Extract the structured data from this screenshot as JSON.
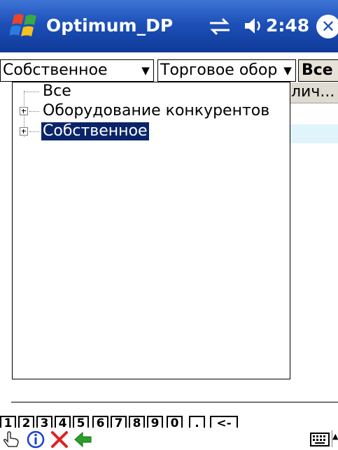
{
  "titlebar": {
    "app_title": "Optimum_DP",
    "clock": "2:48",
    "close_glyph": "✕",
    "icons": [
      "windows-start-icon",
      "sync-icon",
      "volume-icon",
      "close-icon"
    ]
  },
  "filters": {
    "combo1_value": "Собственное",
    "combo2_value": "Торговое обор",
    "all_button": "Все",
    "arrow_glyph": "▼"
  },
  "background_list": {
    "header_partial": "лич..."
  },
  "tree": {
    "nodes": [
      {
        "label": "Все",
        "expandable": false,
        "selected": false
      },
      {
        "label": "Оборудование конкурентов",
        "expandable": true,
        "selected": false
      },
      {
        "label": "Собственное",
        "expandable": true,
        "selected": true
      }
    ]
  },
  "keypad": {
    "keys": [
      "1",
      "2",
      "3",
      "4",
      "5",
      "6",
      "7",
      "8",
      "9",
      "0",
      ".",
      "<-"
    ]
  },
  "commandbar": {
    "icons": [
      "hand-icon",
      "info-icon",
      "delete-icon",
      "back-arrow-icon",
      "keyboard-icon"
    ],
    "sip_glyph": "▲"
  },
  "colors": {
    "titlebar": "#1d50b8",
    "selection": "#0a246a",
    "delete": "#e02020",
    "back_arrow": "#2aa02a",
    "info": "#1a3fd0"
  }
}
